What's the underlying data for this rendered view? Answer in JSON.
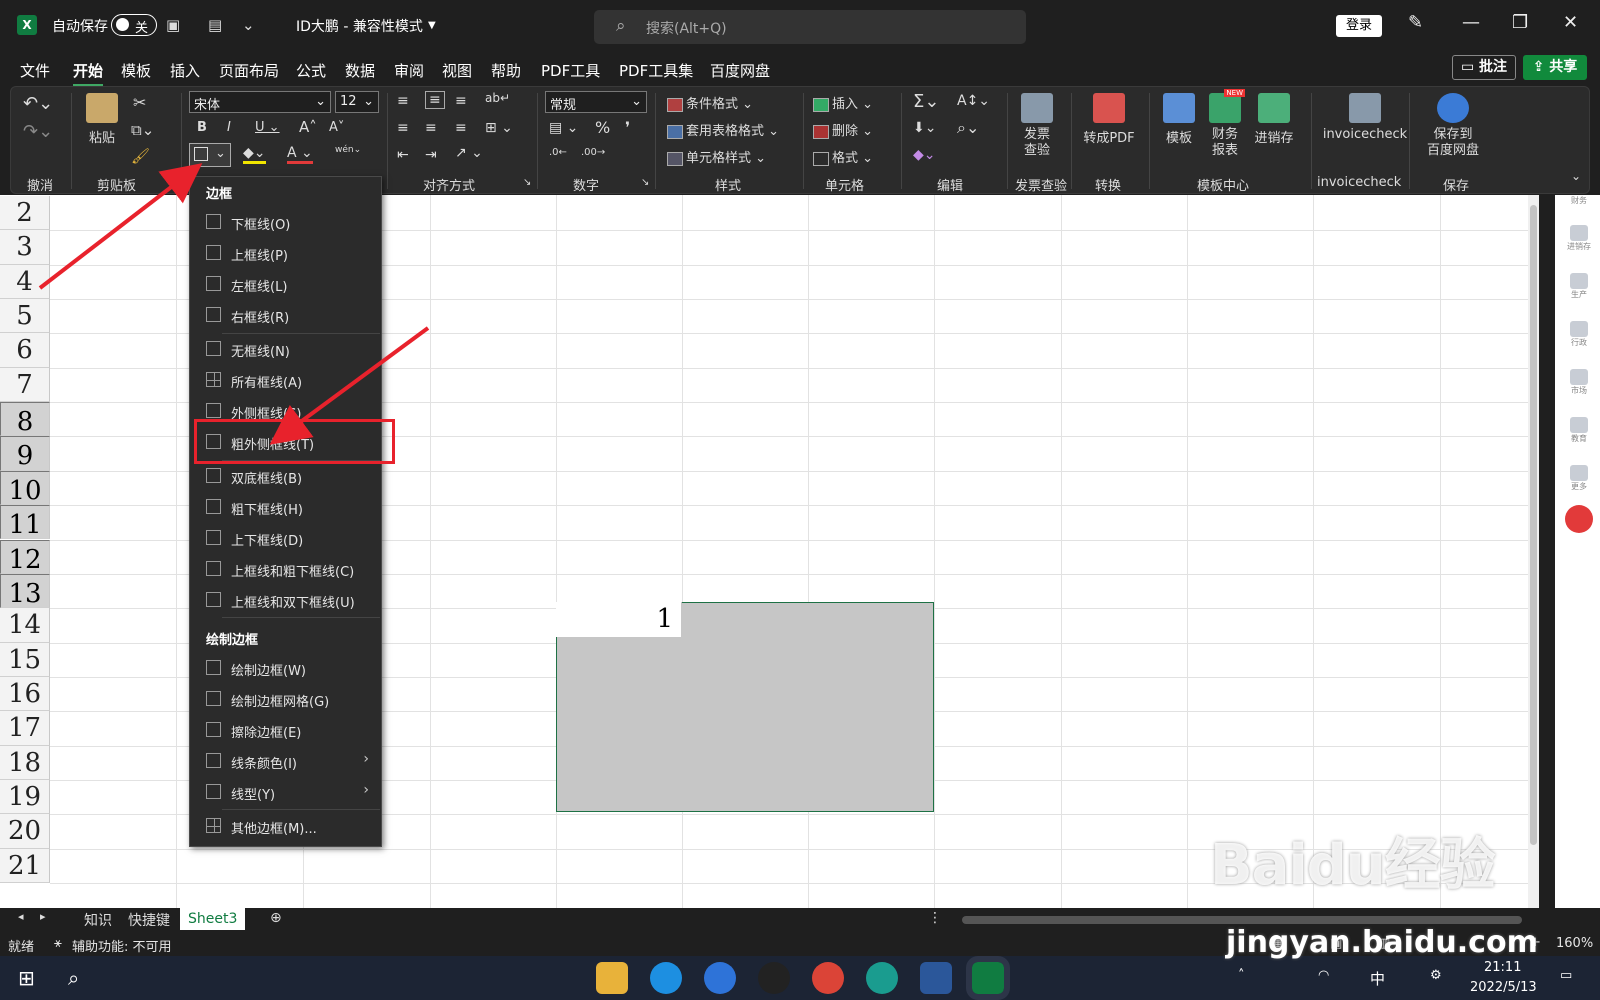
{
  "titlebar": {
    "autosave_label": "自动保存",
    "autosave_state": "关",
    "doc_title": "ID大鹏  -  兼容性模式",
    "search_placeholder": "搜索(Alt+Q)",
    "login_label": "登录"
  },
  "menubar": {
    "items": [
      "文件",
      "开始",
      "模板",
      "插入",
      "页面布局",
      "公式",
      "数据",
      "审阅",
      "视图",
      "帮助",
      "PDF工具",
      "PDF工具集",
      "百度网盘"
    ],
    "active": "开始",
    "comment_label": "批注",
    "share_label": "共享"
  },
  "ribbon": {
    "groups": {
      "undo": "撤消",
      "clipboard": "剪贴板",
      "align": "对齐方式",
      "number": "数字",
      "styles": "样式",
      "cells": "单元格",
      "edit": "编辑",
      "invoice": "发票查验",
      "convert": "转换",
      "template_center": "模板中心",
      "invoicecheck": "invoicecheck",
      "save": "保存"
    },
    "paste_label": "粘贴",
    "font_name": "宋体",
    "font_size": "12",
    "number_format": "常规",
    "conditional_format": "条件格式",
    "table_format": "套用表格格式",
    "cell_style": "单元格样式",
    "insert": "插入",
    "delete": "删除",
    "format": "格式",
    "invoice_btn": "发票\n查验",
    "to_pdf": "转成PDF",
    "template_btn": "模板",
    "finance_btn": "财务\n报表",
    "inventory_btn": "进销存",
    "invoicecheck_btn": "invoicecheck",
    "save_baidu_btn": "保存到\n百度网盘",
    "new_badge": "NEW"
  },
  "border_menu": {
    "section1": "边框",
    "items": [
      {
        "label": "下框线(O)"
      },
      {
        "label": "上框线(P)"
      },
      {
        "label": "左框线(L)"
      },
      {
        "label": "右框线(R)"
      },
      {
        "label": "无框线(N)"
      },
      {
        "label": "所有框线(A)"
      },
      {
        "label": "外侧框线(S)"
      },
      {
        "label": "粗外侧框线(T)"
      },
      {
        "label": "双底框线(B)"
      },
      {
        "label": "粗下框线(H)"
      },
      {
        "label": "上下框线(D)"
      },
      {
        "label": "上框线和粗下框线(C)"
      },
      {
        "label": "上框线和双下框线(U)"
      }
    ],
    "section2": "绘制边框",
    "draw_items": [
      {
        "label": "绘制边框(W)"
      },
      {
        "label": "绘制边框网格(G)"
      },
      {
        "label": "擦除边框(E)"
      },
      {
        "label": "线条颜色(I)"
      },
      {
        "label": "线型(Y)"
      }
    ],
    "more": "其他边框(M)..."
  },
  "grid": {
    "rows": [
      "2",
      "3",
      "4",
      "5",
      "6",
      "7",
      "8",
      "9",
      "10",
      "11",
      "12",
      "13",
      "14",
      "15",
      "16",
      "17",
      "18",
      "19",
      "20",
      "21"
    ],
    "active_cell_value": "1"
  },
  "sidepane": {
    "items": [
      "财务",
      "进销存",
      "生产",
      "行政",
      "市场",
      "教育",
      "更多"
    ]
  },
  "sheets": {
    "tabs": [
      "知识",
      "快捷键",
      "Sheet3"
    ],
    "active": "Sheet3"
  },
  "status": {
    "ready": "就绪",
    "accessibility": "辅助功能: 不可用",
    "zoom": "160%"
  },
  "taskbar": {
    "ime": "中",
    "time": "21:11",
    "date": "2022/5/13"
  },
  "watermark": {
    "brand": "Baidu经验",
    "url": "jingyan.baidu.com"
  },
  "colors": {
    "excel_green": "#107c41",
    "highlight_red": "#e8222c",
    "selection_gray": "#c6c6c6"
  }
}
